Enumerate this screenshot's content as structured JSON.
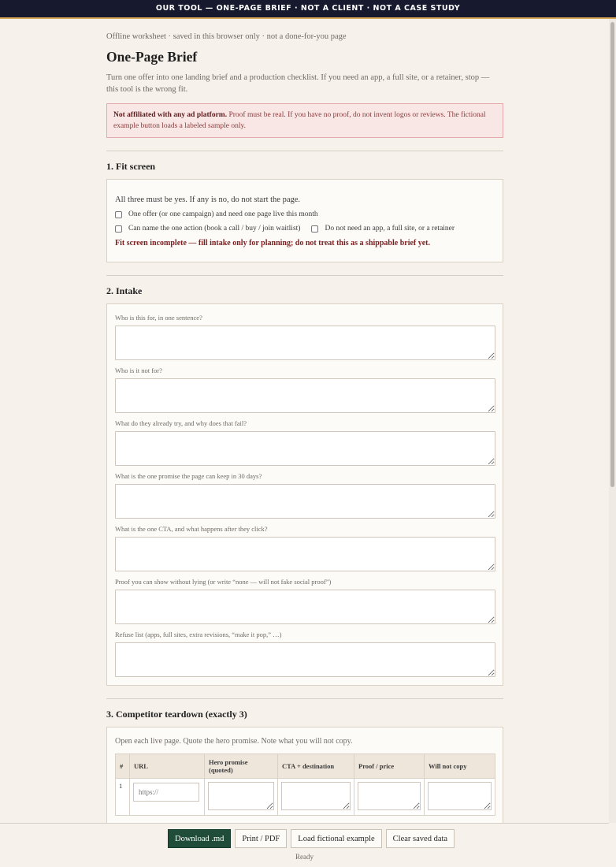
{
  "banner": "OUR TOOL — ONE-PAGE BRIEF · NOT A CLIENT · NOT A CASE STUDY",
  "worksheet_note": "Offline worksheet · saved in this browser only · not a done-for-you page",
  "title": "One-Page Brief",
  "intro": "Turn one offer into one landing brief and a production checklist. If you need an app, a full site, or a retainer, stop — this tool is the wrong fit.",
  "notice": {
    "strong": "Not affiliated with any ad platform.",
    "text": " Proof must be real. If you have no proof, do not invent logos or reviews. The fictional example button loads a labeled sample only."
  },
  "fit": {
    "heading": "1. Fit screen",
    "intro": "All three must be yes. If any is no, do not start the page.",
    "checks": [
      "One offer (or one campaign) and need one page live this month",
      "Can name the one action (book a call / buy / join waitlist)",
      "Do not need an app, a full site, or a retainer"
    ],
    "warning": "Fit screen incomplete — fill intake only for planning; do not treat this as a shippable brief yet."
  },
  "intake": {
    "heading": "2. Intake",
    "fields": [
      "Who is this for, in one sentence?",
      "Who is it not for?",
      "What do they already try, and why does that fail?",
      "What is the one promise the page can keep in 30 days?",
      "What is the one CTA, and what happens after they click?",
      "Proof you can show without lying (or write “none — will not fake social proof”)",
      "Refuse list (apps, full sites, extra revisions, “make it pop,” …)"
    ]
  },
  "teardown": {
    "heading": "3. Competitor teardown (exactly 3)",
    "intro": "Open each live page. Quote the hero promise. Note what you will not copy.",
    "columns": [
      "#",
      "URL",
      "Hero promise (quoted)",
      "CTA + destination",
      "Proof / price",
      "Will not copy"
    ],
    "row_number": "1",
    "url_placeholder": "https://"
  },
  "actions": {
    "download": "Download .md",
    "print": "Print / PDF",
    "load_example": "Load fictional example",
    "clear": "Clear saved data"
  },
  "status": "Ready"
}
